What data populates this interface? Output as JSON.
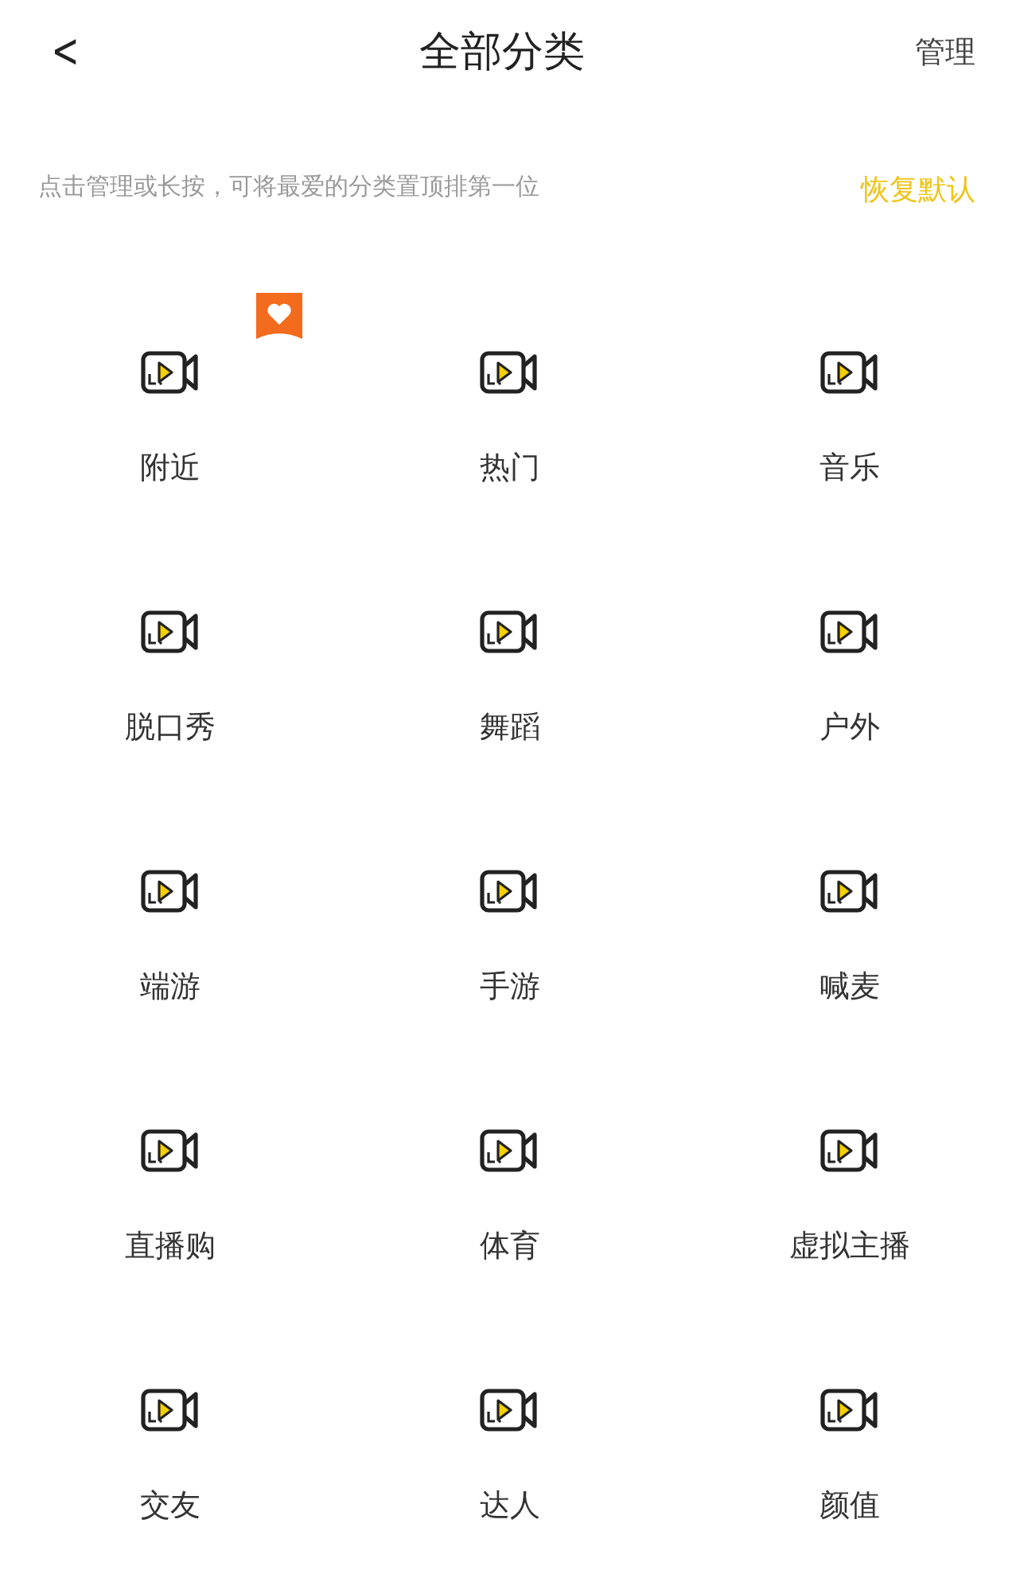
{
  "header": {
    "back": "<",
    "title": "全部分类",
    "action": "管理"
  },
  "hint": {
    "text": "点击管理或长按，可将最爱的分类置顶排第一位",
    "restore": "恢复默认"
  },
  "categories": [
    {
      "label": "附近",
      "pinned": true
    },
    {
      "label": "热门",
      "pinned": false
    },
    {
      "label": "音乐",
      "pinned": false
    },
    {
      "label": "脱口秀",
      "pinned": false
    },
    {
      "label": "舞蹈",
      "pinned": false
    },
    {
      "label": "户外",
      "pinned": false
    },
    {
      "label": "端游",
      "pinned": false
    },
    {
      "label": "手游",
      "pinned": false
    },
    {
      "label": "喊麦",
      "pinned": false
    },
    {
      "label": "直播购",
      "pinned": false
    },
    {
      "label": "体育",
      "pinned": false
    },
    {
      "label": "虚拟主播",
      "pinned": false
    },
    {
      "label": "交友",
      "pinned": false
    },
    {
      "label": "达人",
      "pinned": false
    },
    {
      "label": "颜值",
      "pinned": false
    }
  ]
}
